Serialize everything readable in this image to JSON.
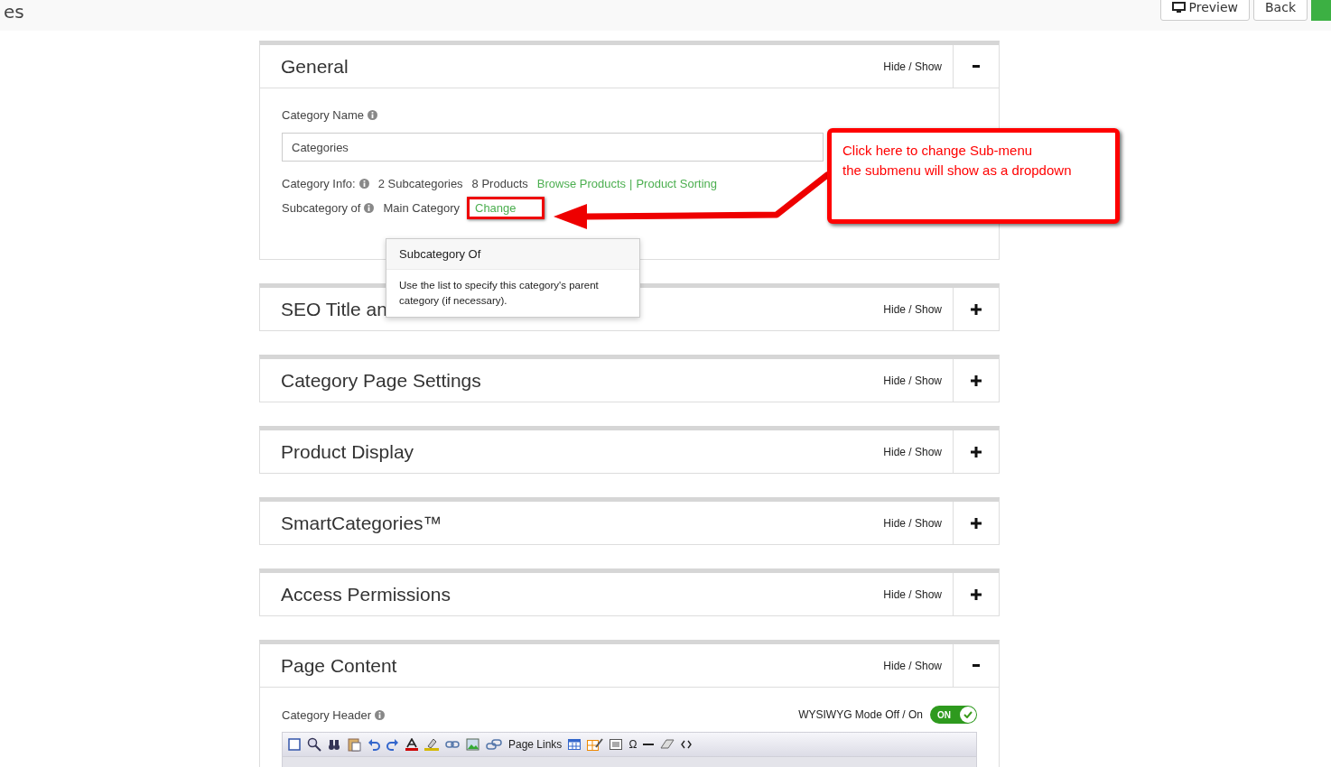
{
  "top_bar": {
    "title": "es",
    "buttons": [
      {
        "label": "Preview",
        "kind": "preview"
      },
      {
        "label": "Back",
        "kind": "plain"
      }
    ]
  },
  "sections": [
    {
      "title": "General",
      "hide_show": "Hide / Show",
      "expanded": true,
      "kind": "general"
    },
    {
      "title": "SEO Title an",
      "hide_show": "Hide / Show",
      "expanded": false,
      "kind": "plain"
    },
    {
      "title": "Category Page Settings",
      "hide_show": "Hide / Show",
      "expanded": false,
      "kind": "plain"
    },
    {
      "title": "Product Display",
      "hide_show": "Hide / Show",
      "expanded": false,
      "kind": "plain"
    },
    {
      "title": "SmartCategories™",
      "hide_show": "Hide / Show",
      "expanded": false,
      "kind": "plain"
    },
    {
      "title": "Access Permissions",
      "hide_show": "Hide / Show",
      "expanded": false,
      "kind": "plain"
    },
    {
      "title": "Page Content",
      "hide_show": "Hide / Show",
      "expanded": true,
      "kind": "page_content"
    }
  ],
  "general": {
    "name_label": "Category Name",
    "name_value": "Categories",
    "info_label": "Category Info:",
    "subcategories": "2 Subcategories",
    "products": "8 Products",
    "links": [
      "Browse Products",
      "Product Sorting"
    ],
    "link_separator": "|",
    "parent_label": "Subcategory of",
    "parent_value": "Main Category",
    "change_link": "Change"
  },
  "tooltip": {
    "title": "Subcategory Of",
    "text": "Use the list to specify this category's parent category (if necessary)."
  },
  "callout": {
    "lines": [
      "Click here to change Sub-menu",
      "the submenu will show as a dropdown"
    ]
  },
  "page_content": {
    "header_label": "Category Header",
    "mode_label": "WYSIWYG Mode Off / On",
    "mode_switch": {
      "on": true,
      "label": "ON"
    },
    "toolbar_link": "Page Links",
    "toolbar_glyph": "Ω"
  }
}
